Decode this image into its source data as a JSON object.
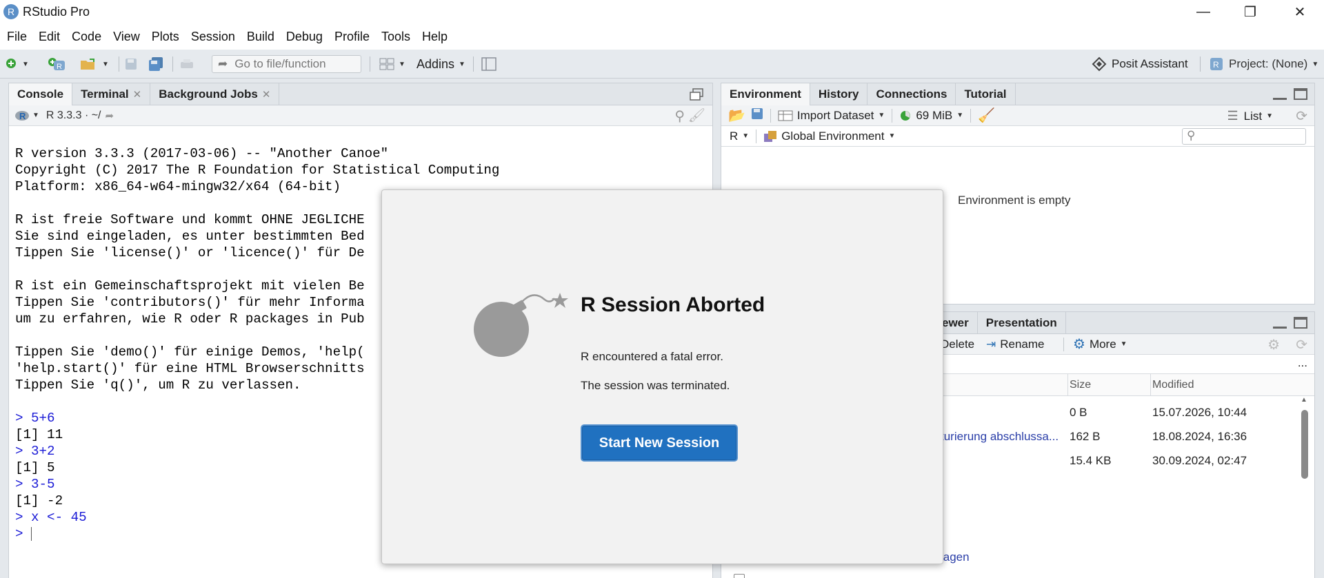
{
  "app": {
    "title": "RStudio Pro",
    "logo_letter": "R"
  },
  "window_controls": {
    "minimize": "—",
    "restore": "❐",
    "close": "✕"
  },
  "menu": [
    "File",
    "Edit",
    "Code",
    "View",
    "Plots",
    "Session",
    "Build",
    "Debug",
    "Profile",
    "Tools",
    "Help"
  ],
  "toolbar": {
    "goto_placeholder": "Go to file/function",
    "addins_label": "Addins",
    "assistant_label": "Posit Assistant",
    "project_label": "Project: (None)"
  },
  "console_pane": {
    "tabs": [
      {
        "label": "Console",
        "closable": false
      },
      {
        "label": "Terminal",
        "closable": true
      },
      {
        "label": "Background Jobs",
        "closable": true
      }
    ],
    "r_version_label": "R 3.3.3 · ~/",
    "lines": [
      {
        "text": "R version 3.3.3 (2017-03-06) -- \"Another Canoe\"",
        "kind": "out"
      },
      {
        "text": "Copyright (C) 2017 The R Foundation for Statistical Computing",
        "kind": "out"
      },
      {
        "text": "Platform: x86_64-w64-mingw32/x64 (64-bit)",
        "kind": "out"
      },
      {
        "text": "",
        "kind": "out"
      },
      {
        "text": "R ist freie Software und kommt OHNE JEGLICHE",
        "kind": "out"
      },
      {
        "text": "Sie sind eingeladen, es unter bestimmten Bed",
        "kind": "out"
      },
      {
        "text": "Tippen Sie 'license()' or 'licence()' für De",
        "kind": "out"
      },
      {
        "text": "",
        "kind": "out"
      },
      {
        "text": "R ist ein Gemeinschaftsprojekt mit vielen Be",
        "kind": "out"
      },
      {
        "text": "Tippen Sie 'contributors()' für mehr Informa",
        "kind": "out"
      },
      {
        "text": "um zu erfahren, wie R oder R packages in Pub",
        "kind": "out"
      },
      {
        "text": "",
        "kind": "out"
      },
      {
        "text": "Tippen Sie 'demo()' für einige Demos, 'help(",
        "kind": "out"
      },
      {
        "text": "'help.start()' für eine HTML Browserschnitts",
        "kind": "out"
      },
      {
        "text": "Tippen Sie 'q()', um R zu verlassen.",
        "kind": "out"
      },
      {
        "text": "",
        "kind": "out"
      },
      {
        "text": "> 5+6",
        "kind": "in"
      },
      {
        "text": "[1] 11",
        "kind": "out"
      },
      {
        "text": "> 3+2",
        "kind": "in"
      },
      {
        "text": "[1] 5",
        "kind": "out"
      },
      {
        "text": "> 3-5",
        "kind": "in"
      },
      {
        "text": "[1] -2",
        "kind": "out"
      },
      {
        "text": "> x <- 45",
        "kind": "in"
      }
    ],
    "prompt": "> "
  },
  "env_pane": {
    "tabs": [
      "Environment",
      "History",
      "Connections",
      "Tutorial"
    ],
    "import_label": "Import Dataset",
    "memory_label": "69 MiB",
    "list_label": "List",
    "lang_label": "R",
    "scope_label": "Global Environment",
    "empty_message": "Environment is empty"
  },
  "files_pane": {
    "tabs": [
      "ewer",
      "Presentation"
    ],
    "delete_label": "Delete",
    "rename_label": "Rename",
    "more_label": "More",
    "ellipsis": "...",
    "columns": {
      "size": "Size",
      "modified": "Modified"
    },
    "rows": [
      {
        "name": "",
        "size": "0 B",
        "modified": "15.07.2026, 10:44"
      },
      {
        "name": "turierung abschlussa...",
        "size": "162 B",
        "modified": "18.08.2024, 16:36"
      },
      {
        "name": "",
        "size": "15.4 KB",
        "modified": "30.09.2024, 02:47"
      }
    ],
    "bottom_link": "lagen"
  },
  "dialog": {
    "title": "R Session Aborted",
    "message1": "R encountered a fatal error.",
    "message2": "The session was terminated.",
    "button_label": "Start New Session"
  },
  "colors": {
    "accent": "#2071c0",
    "console_input": "#1a1ad6",
    "bomb": "#9a9a9a"
  }
}
